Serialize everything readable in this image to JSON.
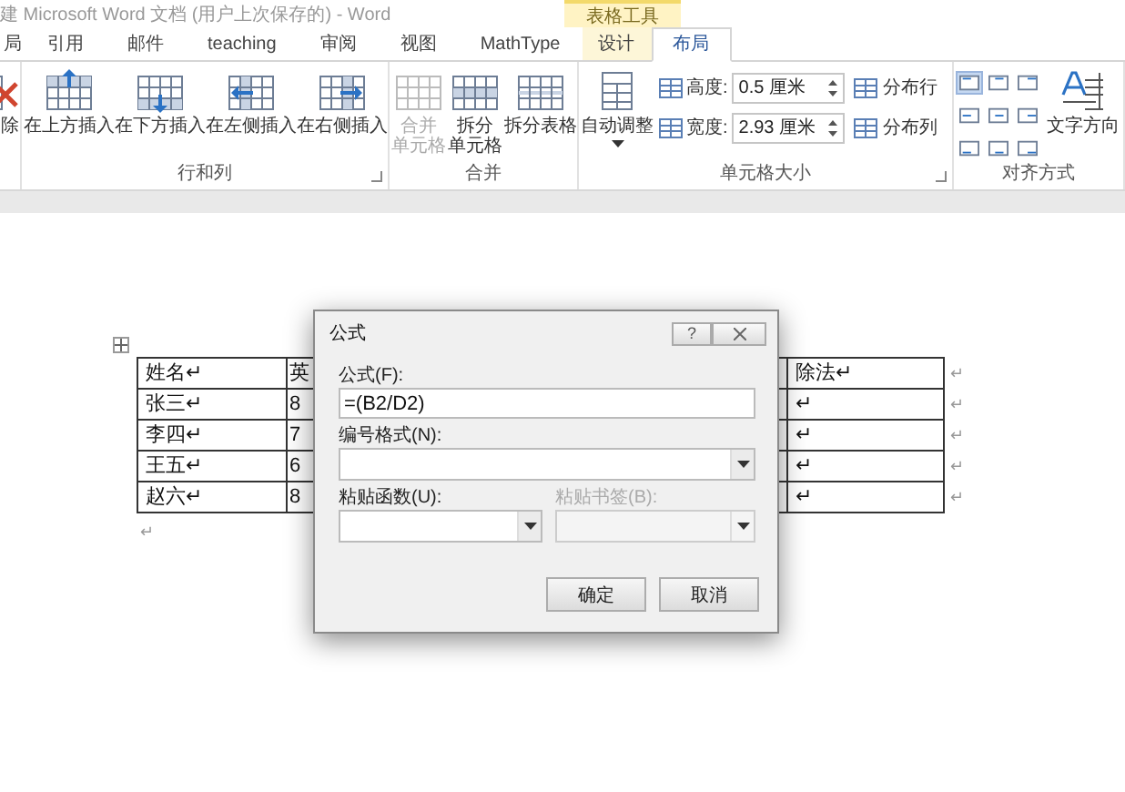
{
  "title_bar": {
    "title": "建 Microsoft Word 文档 (用户上次保存的) - Word",
    "context_label": "表格工具"
  },
  "tabs": [
    {
      "label": "局",
      "selected": false,
      "context": false
    },
    {
      "label": "引用",
      "selected": false,
      "context": false
    },
    {
      "label": "邮件",
      "selected": false,
      "context": false
    },
    {
      "label": "teaching",
      "selected": false,
      "context": false
    },
    {
      "label": "审阅",
      "selected": false,
      "context": false
    },
    {
      "label": "视图",
      "selected": false,
      "context": false
    },
    {
      "label": "MathType",
      "selected": false,
      "context": false
    },
    {
      "label": "设计",
      "selected": false,
      "context": true
    },
    {
      "label": "布局",
      "selected": true,
      "context": true
    }
  ],
  "ribbon": {
    "groups": [
      {
        "items": [
          {
            "kind": "large",
            "label": "除",
            "disabled": false
          }
        ]
      },
      {
        "label": "行和列",
        "launcher": true,
        "items": [
          {
            "kind": "large",
            "label": "在上方插入",
            "disabled": false
          },
          {
            "kind": "large",
            "label": "在下方插入",
            "disabled": false
          },
          {
            "kind": "large",
            "label": "在左侧插入",
            "disabled": false
          },
          {
            "kind": "large",
            "label": "在右侧插入",
            "disabled": false
          }
        ]
      },
      {
        "label": "合并",
        "launcher": false,
        "items": [
          {
            "kind": "large",
            "label": "合并单元格",
            "disabled": true
          },
          {
            "kind": "large",
            "label": "拆分单元格",
            "disabled": false
          },
          {
            "kind": "large",
            "label": "拆分表格",
            "disabled": false
          }
        ]
      },
      {
        "label": "单元格大小",
        "launcher": true,
        "items": [
          {
            "kind": "dropdown",
            "label": "自动调整",
            "disabled": false
          },
          {
            "kind": "spinners",
            "rows": [
              {
                "label": "高度:",
                "value": "0.5 厘米"
              },
              {
                "label": "宽度:",
                "value": "2.93 厘米"
              }
            ]
          },
          {
            "kind": "small_stack",
            "rows": [
              {
                "label": "分布行"
              },
              {
                "label": "分布列"
              }
            ]
          }
        ]
      },
      {
        "label": "对齐方式",
        "launcher": false,
        "items": [
          {
            "kind": "align_grid",
            "cells": [
              {
                "selected": true
              },
              {
                "selected": false
              },
              {
                "selected": false
              },
              {
                "selected": false
              },
              {
                "selected": false
              },
              {
                "selected": false
              },
              {
                "selected": false
              },
              {
                "selected": false
              },
              {
                "selected": false
              }
            ]
          },
          {
            "kind": "large",
            "label": "文字方向",
            "disabled": false
          }
        ]
      }
    ]
  },
  "document": {
    "table": {
      "rows": [
        {
          "cells": [
            "姓名↵",
            "英",
            "除法↵"
          ],
          "end_mark": "↵"
        },
        {
          "cells": [
            "张三↵",
            "8",
            "↵"
          ],
          "end_mark": "↵"
        },
        {
          "cells": [
            "李四↵",
            "7",
            "↵"
          ],
          "end_mark": "↵"
        },
        {
          "cells": [
            "王五↵",
            "6",
            "↵"
          ],
          "end_mark": "↵"
        },
        {
          "cells": [
            "赵六↵",
            "8",
            "↵"
          ],
          "end_mark": "↵"
        }
      ]
    },
    "paragraph_mark": "↵"
  },
  "dialog": {
    "title": "公式",
    "help": "?",
    "formula": {
      "label": "公式(F):",
      "value": "=(B2/D2)"
    },
    "number_format": {
      "label": "编号格式(N):"
    },
    "paste_function": {
      "label": "粘贴函数(U):",
      "disabled": false
    },
    "paste_bookmark": {
      "label": "粘贴书签(B):",
      "disabled": true
    },
    "buttons": [
      {
        "label": "确定"
      },
      {
        "label": "取消"
      }
    ]
  }
}
